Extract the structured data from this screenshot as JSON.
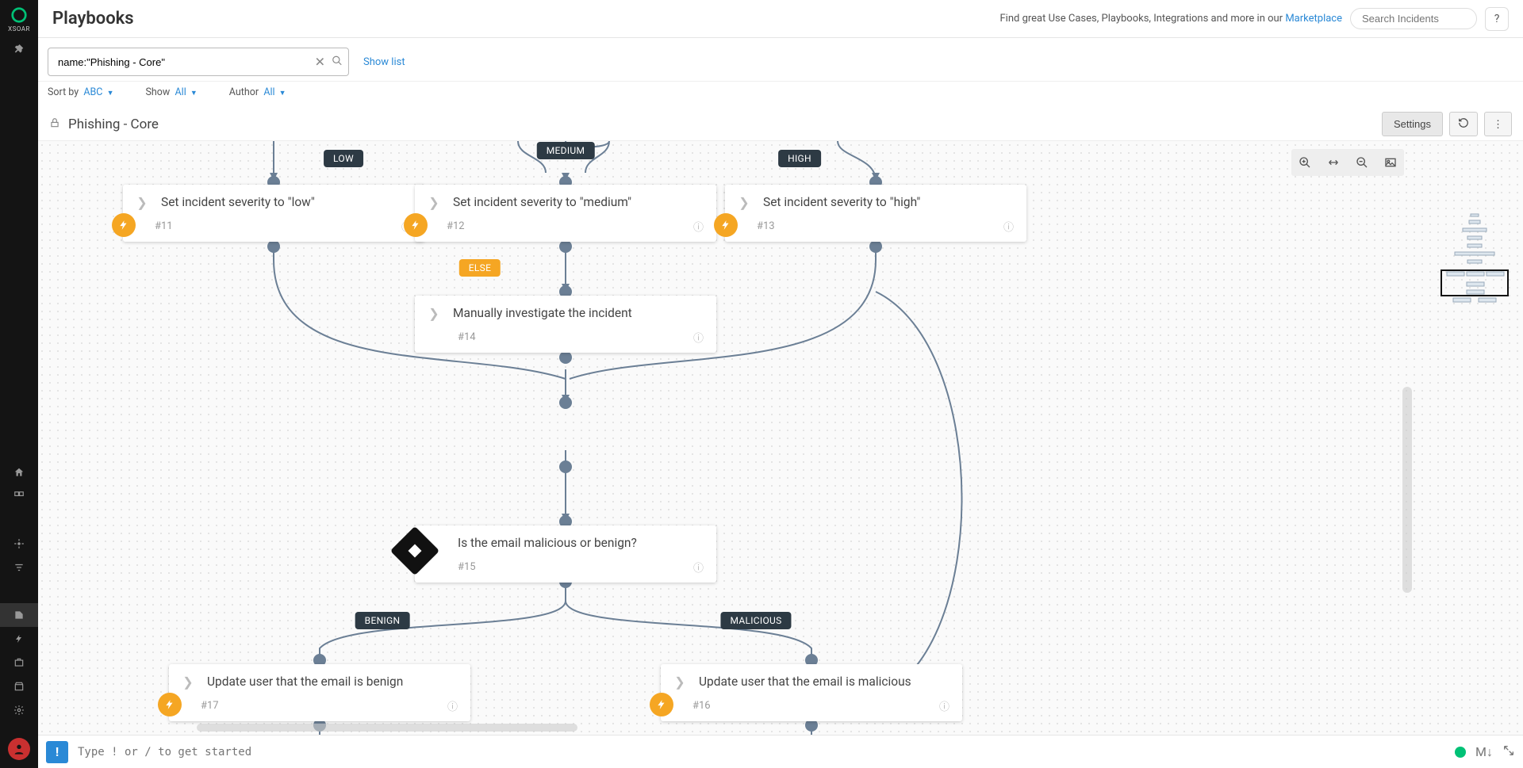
{
  "app_name": "XSOAR",
  "page_title": "Playbooks",
  "header": {
    "promo_prefix": "Find great Use Cases, Playbooks, Integrations and more in our ",
    "promo_link": "Marketplace",
    "search_placeholder": "Search Incidents",
    "help": "?"
  },
  "filter": {
    "query": "name:\"Phishing - Core\"",
    "show_list": "Show list",
    "sort_label": "Sort by",
    "sort_value": "ABC",
    "show_label": "Show",
    "show_value": "All",
    "author_label": "Author",
    "author_value": "All"
  },
  "playbook": {
    "title": "Phishing - Core",
    "settings_btn": "Settings"
  },
  "labels": {
    "low": "LOW",
    "medium": "MEDIUM",
    "high": "HIGH",
    "else": "ELSE",
    "benign": "BENIGN",
    "malicious": "MALICIOUS"
  },
  "nodes": {
    "n11": {
      "title": "Set incident severity to \"low\"",
      "id": "#11"
    },
    "n12": {
      "title": "Set incident severity to \"medium\"",
      "id": "#12"
    },
    "n13": {
      "title": "Set incident severity to \"high\"",
      "id": "#13"
    },
    "n14": {
      "title": "Manually investigate the incident",
      "id": "#14"
    },
    "n15": {
      "title": "Is the email malicious or benign?",
      "id": "#15"
    },
    "n16": {
      "title": "Update user that the email is malicious",
      "id": "#16"
    },
    "n17": {
      "title": "Update user that the email is benign",
      "id": "#17"
    }
  },
  "cmd": {
    "placeholder": "Type ! or / to get started",
    "markdown": "M↓"
  }
}
